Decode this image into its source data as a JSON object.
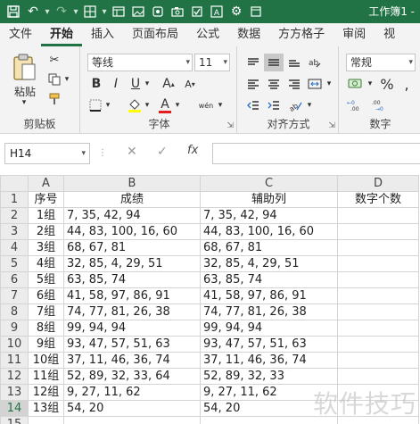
{
  "window": {
    "title": "工作簿1 -"
  },
  "qat": {
    "icons": [
      "save-icon",
      "undo-icon",
      "redo-icon",
      "border-icon",
      "table-icon",
      "image-icon",
      "app-icon",
      "camera-icon",
      "checkbox-icon",
      "text-icon",
      "settings-icon",
      "window-icon"
    ]
  },
  "tabs": [
    {
      "label": "文件"
    },
    {
      "label": "开始"
    },
    {
      "label": "插入"
    },
    {
      "label": "页面布局"
    },
    {
      "label": "公式"
    },
    {
      "label": "数据"
    },
    {
      "label": "方方格子"
    },
    {
      "label": "审阅"
    },
    {
      "label": "视"
    }
  ],
  "ribbon": {
    "clipboard": {
      "label": "剪贴板",
      "paste": "粘贴"
    },
    "font": {
      "label": "字体",
      "font_name": "等线",
      "font_size": "11",
      "bold": "B",
      "italic": "I",
      "underline": "U",
      "font_color": "A",
      "increase": "A",
      "decrease": "A",
      "wen": "wén"
    },
    "alignment": {
      "label": "对齐方式"
    },
    "number": {
      "label": "数字",
      "format": "常规",
      "percent": "%"
    }
  },
  "formula_bar": {
    "name_box": "H14",
    "fx": "fx",
    "formula": ""
  },
  "sheet": {
    "columns": [
      "A",
      "B",
      "C",
      "D"
    ],
    "selected_row": 14,
    "rows": [
      {
        "n": "1",
        "a": "序号",
        "b": "成绩",
        "c": "辅助列",
        "d": "数字个数"
      },
      {
        "n": "2",
        "a": "1组",
        "b": "7, 35, 42, 94",
        "c": "7, 35, 42, 94",
        "d": ""
      },
      {
        "n": "3",
        "a": "2组",
        "b": "44, 83, 100, 16, 60",
        "c": "44, 83, 100, 16, 60",
        "d": ""
      },
      {
        "n": "4",
        "a": "3组",
        "b": "68, 67, 81",
        "c": "68, 67, 81",
        "d": ""
      },
      {
        "n": "5",
        "a": "4组",
        "b": "32, 85, 4, 29, 51",
        "c": "32, 85, 4, 29, 51",
        "d": ""
      },
      {
        "n": "6",
        "a": "5组",
        "b": "63, 85, 74",
        "c": "63, 85, 74",
        "d": ""
      },
      {
        "n": "7",
        "a": "6组",
        "b": "41, 58, 97, 86, 91",
        "c": "41, 58, 97, 86, 91",
        "d": ""
      },
      {
        "n": "8",
        "a": "7组",
        "b": "74, 77, 81, 26, 38",
        "c": "74, 77, 81, 26, 38",
        "d": ""
      },
      {
        "n": "9",
        "a": "8组",
        "b": "99, 94, 94",
        "c": "99, 94, 94",
        "d": ""
      },
      {
        "n": "10",
        "a": "9组",
        "b": "93, 47, 57, 51, 63",
        "c": "93, 47, 57, 51, 63",
        "d": ""
      },
      {
        "n": "11",
        "a": "10组",
        "b": "37, 11, 46, 36, 74",
        "c": "37, 11, 46, 36, 74",
        "d": ""
      },
      {
        "n": "12",
        "a": "11组",
        "b": "52, 89, 32, 33, 64",
        "c": "52, 89, 32, 33",
        "d": ""
      },
      {
        "n": "13",
        "a": "12组",
        "b": "9, 27, 11, 62",
        "c": "9, 27, 11, 62",
        "d": ""
      },
      {
        "n": "14",
        "a": "13组",
        "b": "54, 20",
        "c": "54, 20",
        "d": ""
      },
      {
        "n": "15",
        "a": "",
        "b": "",
        "c": "",
        "d": ""
      }
    ]
  },
  "watermark": "软件技巧",
  "colors": {
    "accent": "#217346"
  }
}
